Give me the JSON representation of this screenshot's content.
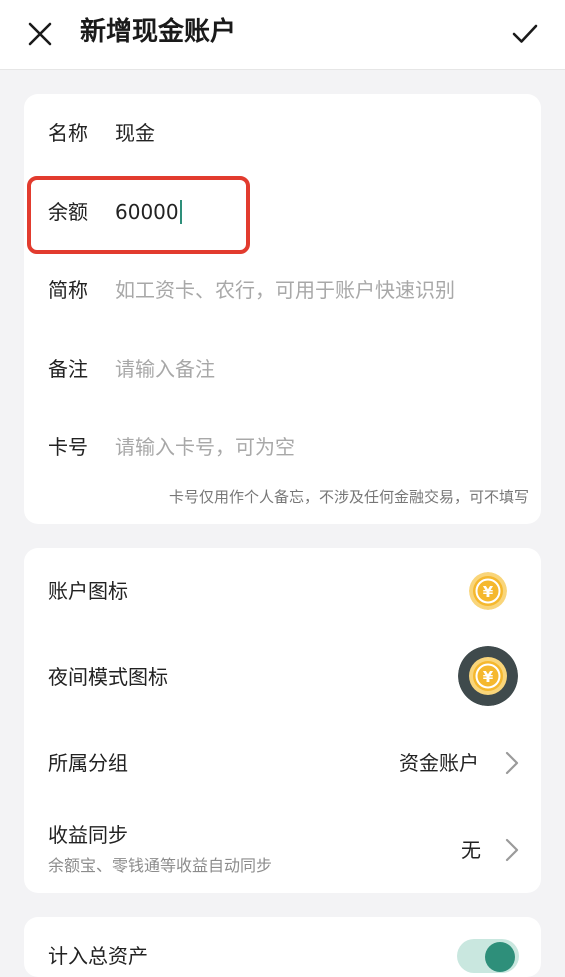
{
  "header": {
    "close_icon": "close-icon",
    "title": "新增现金账户",
    "confirm_icon": "check-icon"
  },
  "form": {
    "name": {
      "label": "名称",
      "value": "现金"
    },
    "balance": {
      "label": "余额",
      "value": "60000"
    },
    "alias": {
      "label": "简称",
      "placeholder": "如工资卡、农行，可用于账户快速识别"
    },
    "note": {
      "label": "备注",
      "placeholder": "请输入备注"
    },
    "card_no": {
      "label": "卡号",
      "placeholder": "请输入卡号，可为空"
    },
    "card_hint": "卡号仅用作个人备忘，不涉及任何金融交易，可不填写"
  },
  "settings": {
    "account_icon": {
      "label": "账户图标",
      "icon": "yuan-coin-icon"
    },
    "night_icon": {
      "label": "夜间模式图标",
      "icon": "yuan-coin-dark-icon"
    },
    "group": {
      "label": "所属分组",
      "value": "资金账户"
    },
    "sync": {
      "label": "收益同步",
      "sub": "余额宝、零钱通等收益自动同步",
      "value": "无"
    }
  },
  "total_assets": {
    "label": "计入总资产",
    "enabled": true
  },
  "colors": {
    "accent": "#2e8f7a",
    "highlight": "#e23b2e",
    "coin": "#f5b82e"
  }
}
